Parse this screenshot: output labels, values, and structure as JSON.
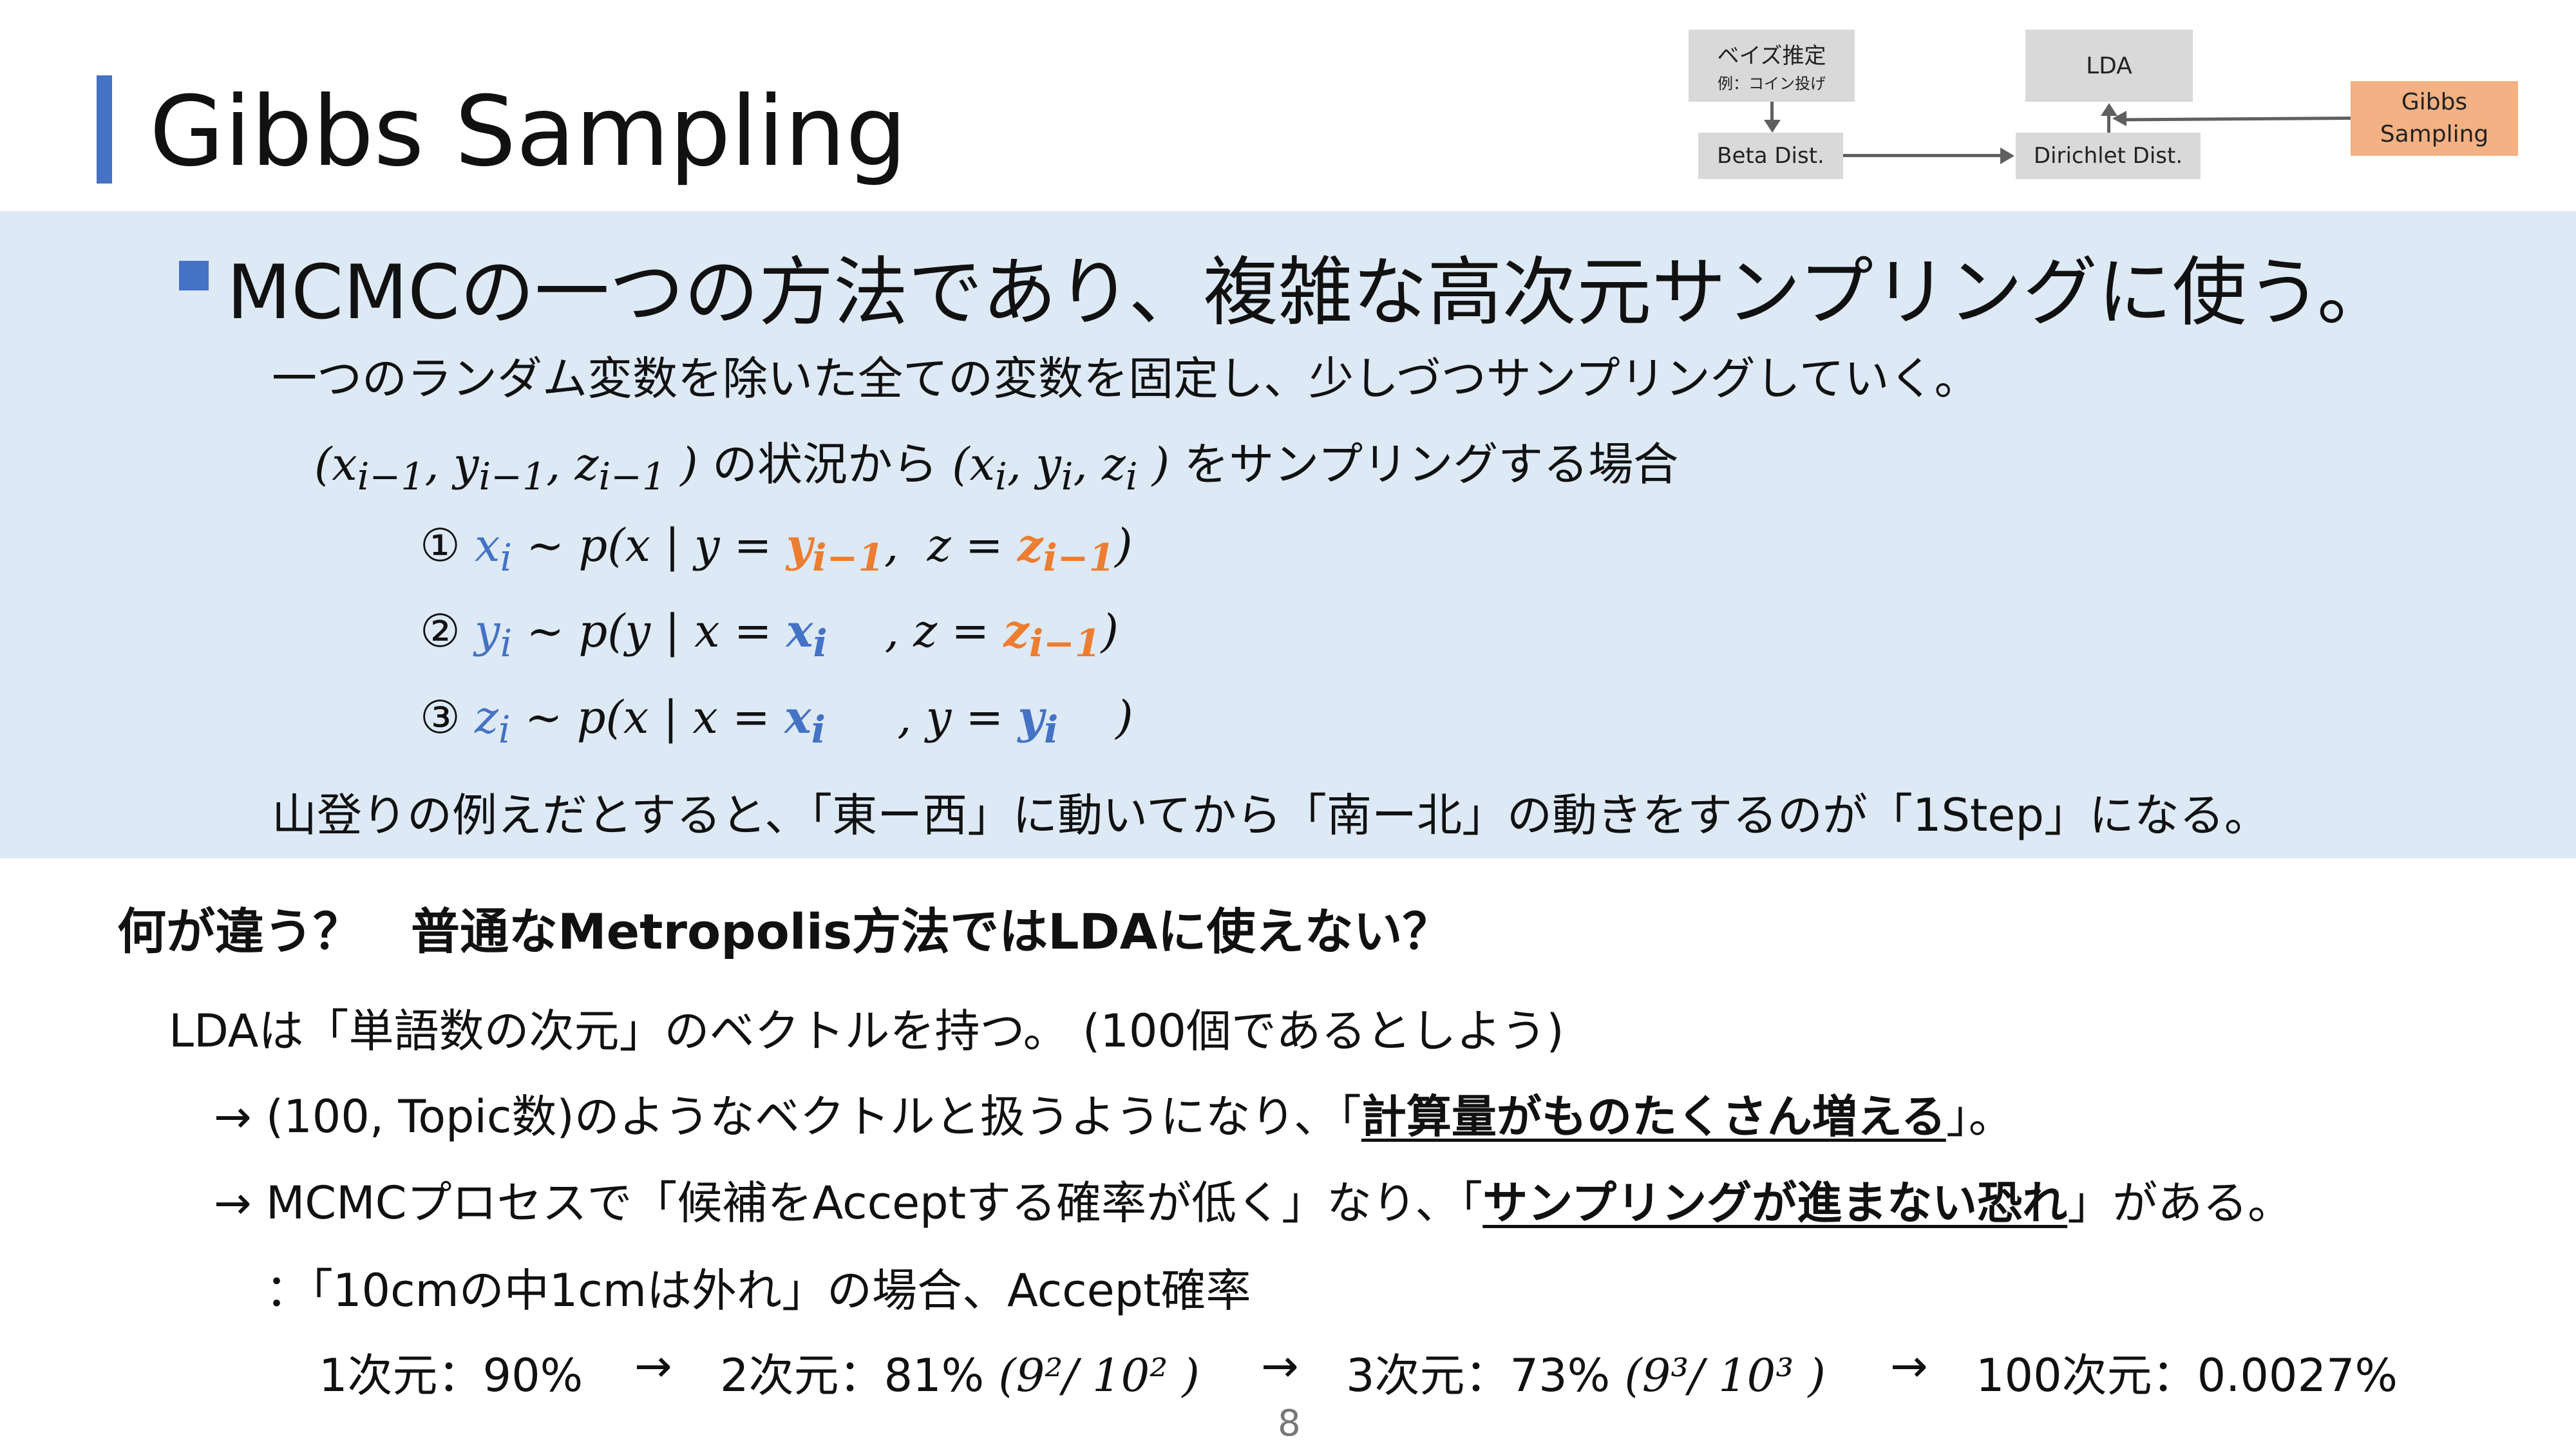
{
  "slide": {
    "title": "Gibbs Sampling",
    "page_number": "8",
    "colors": {
      "accent": "#4472c4",
      "band": "#dde9f5",
      "orange": "#ed7d31",
      "diagram_box": "#d9d9d9",
      "diagram_highlight": "#f4b183"
    }
  },
  "diagram": {
    "bayes": "ベイズ推定",
    "bayes_sub": "例：コイン投げ",
    "lda": "LDA",
    "beta": "Beta Dist.",
    "dirichlet": "Dirichlet Dist.",
    "gibbs": "Gibbs Sampling"
  },
  "band": {
    "heading": "MCMCの一つの方法であり、複雑な高次元サンプリングに使う。",
    "line1": "一つのランダム変数を除いた全ての変数を固定し、少しづつサンプリングしていく。",
    "line2_state_prev": "(x<sub>i−1</sub>, y<sub>i−1</sub>, z<sub>i−1</sub> )",
    "line2_mid": "の状況から",
    "line2_state_curr": "(x<sub>i</sub>, y<sub>i</sub>, z<sub>i</sub> )",
    "line2_end": "をサンプリングする場合",
    "step1_num": "①",
    "step2_num": "②",
    "step3_num": "③",
    "analogy": "山登りの例えだとすると、「東ー西」に動いてから「南ー北」の動きをするのが「1Step」になる。"
  },
  "lower": {
    "question": "何が違う？　普通なMetropolis方法ではLDAに使えない？",
    "line1": "LDAは「単語数の次元」のベクトルを持つ。 (100個であるとしよう)",
    "line2_pre": "→ (100, Topic数)のようなベクトルと扱うようになり、「",
    "line2_ul": "計算量がものたくさん増える",
    "line2_post": "」。",
    "line3_pre": "→ MCMCプロセスで「候補をAcceptする確率が低く」なり、「",
    "line3_ul": "サンプリングが進まない恐れ",
    "line3_post": "」がある。",
    "line4": "：「10cmの中1cmは外れ」の場合、Accept確率",
    "dim1": "1次元：90%",
    "dim2": "2次元：81%",
    "dim2_frac": "(9²/ 10² )",
    "dim3": "3次元：73%",
    "dim3_frac": "(9³/ 10³ )",
    "dim100": "100次元：0.0027%",
    "arrow": "→"
  }
}
